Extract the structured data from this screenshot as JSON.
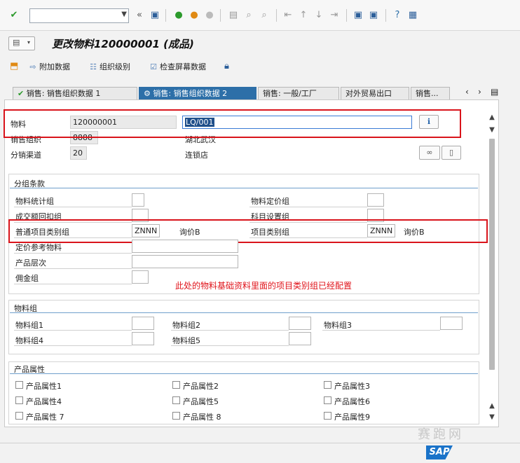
{
  "window": {
    "title": "更改物料120000001 (成品)"
  },
  "toolbar": {
    "command_value": ""
  },
  "app_toolbar": {
    "items": [
      {
        "label": "附加数据"
      },
      {
        "label": "组织级别"
      },
      {
        "label": "检查屏幕数据"
      }
    ]
  },
  "tabs": [
    {
      "label": "销售: 销售组织数据 1",
      "active": false
    },
    {
      "label": "销售: 销售组织数据 2",
      "active": true
    },
    {
      "label": "销售: 一般/工厂",
      "active": false
    },
    {
      "label": "对外贸易出口",
      "active": false
    },
    {
      "label": "销售...",
      "active": false
    }
  ],
  "header": {
    "material_label": "物料",
    "material_value": "120000001",
    "material_desc": "LQ/001",
    "sales_org_label": "销售组织",
    "sales_org_value": "8888",
    "sales_org_desc": "湖北武汉",
    "channel_label": "分销渠道",
    "channel_value": "20",
    "channel_desc": "连锁店"
  },
  "grouping": {
    "title": "分组条款",
    "fields": {
      "mat_stat_group": {
        "label": "物料统计组",
        "value": ""
      },
      "mat_price_group": {
        "label": "物料定价组",
        "value": ""
      },
      "volume_rebate_group": {
        "label": "成交额回扣组",
        "value": ""
      },
      "acct_assign_group": {
        "label": "科目设置组",
        "value": ""
      },
      "gen_item_cat_group": {
        "label": "普通项目类别组",
        "value": "ZNNN",
        "desc": "询价B"
      },
      "item_cat_group": {
        "label": "项目类别组",
        "value": "ZNNN",
        "desc": "询价B"
      },
      "pricing_ref_mat": {
        "label": "定价参考物料",
        "value": ""
      },
      "product_hierarchy": {
        "label": "产品层次",
        "value": ""
      },
      "commission_group": {
        "label": "佣金组",
        "value": ""
      }
    },
    "note": "此处的物料基础资料里面的项目类别组已经配置"
  },
  "material_groups": {
    "title": "物料组",
    "items": [
      {
        "label": "物料组1",
        "value": ""
      },
      {
        "label": "物料组2",
        "value": ""
      },
      {
        "label": "物料组3",
        "value": ""
      },
      {
        "label": "物料组4",
        "value": ""
      },
      {
        "label": "物料组5",
        "value": ""
      }
    ]
  },
  "product_attributes": {
    "title": "产品属性",
    "items": [
      {
        "label": "产品属性1",
        "checked": false
      },
      {
        "label": "产品属性2",
        "checked": false
      },
      {
        "label": "产品属性3",
        "checked": false
      },
      {
        "label": "产品属性4",
        "checked": false
      },
      {
        "label": "产品属性5",
        "checked": false
      },
      {
        "label": "产品属性6",
        "checked": false
      },
      {
        "label": "产品属性 7",
        "checked": false
      },
      {
        "label": "产品属性 8",
        "checked": false
      },
      {
        "label": "产品属性9",
        "checked": false
      }
    ]
  },
  "branding": {
    "logo_text": "SAP",
    "watermark": "赛跑网"
  },
  "colors": {
    "accent": "#2d6fa8",
    "highlight_red": "#d9141b",
    "note_red": "#e0141b"
  }
}
